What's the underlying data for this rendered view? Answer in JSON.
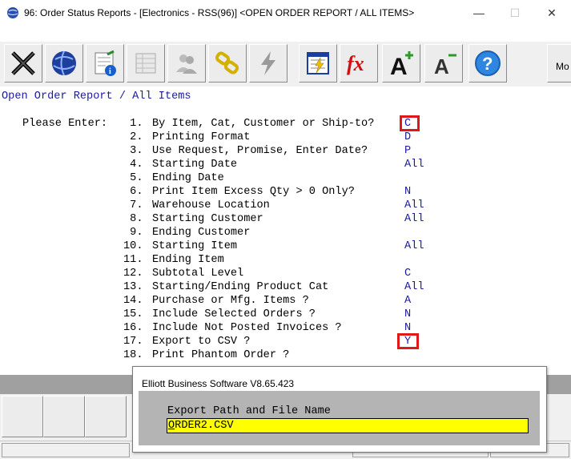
{
  "window": {
    "title": "96: Order Status Reports - [Electronics - RSS(96)] <OPEN ORDER REPORT / ALL ITEMS>",
    "minimize": "—",
    "maximize": "☐",
    "close": "✕"
  },
  "toolbar": {
    "buttons": [
      "exit-icon",
      "globe-icon",
      "notepad-info-icon",
      "grid-icon",
      "users-icon",
      "chain-link-icon",
      "lightning-icon",
      "report-lightning-icon",
      "fx-icon",
      "font-increase-icon",
      "font-decrease-icon",
      "help-icon"
    ],
    "more_label": "Mo"
  },
  "screen": {
    "report_title": "Open Order Report / All Items",
    "prompt_label": "Please Enter:",
    "options": [
      {
        "num": " 1.",
        "label": "By Item, Cat, Customer or Ship-to?",
        "value": "C"
      },
      {
        "num": " 2.",
        "label": "Printing Format",
        "value": "D"
      },
      {
        "num": " 3.",
        "label": "Use Request, Promise, Enter Date?",
        "value": "P"
      },
      {
        "num": " 4.",
        "label": "Starting Date",
        "value": "All"
      },
      {
        "num": " 5.",
        "label": "Ending Date",
        "value": ""
      },
      {
        "num": " 6.",
        "label": "Print Item Excess Qty > 0 Only?",
        "value": "N"
      },
      {
        "num": " 7.",
        "label": "Warehouse Location",
        "value": "All"
      },
      {
        "num": " 8.",
        "label": "Starting Customer",
        "value": "All"
      },
      {
        "num": " 9.",
        "label": "Ending Customer",
        "value": ""
      },
      {
        "num": "10.",
        "label": "Starting Item",
        "value": "All"
      },
      {
        "num": "11.",
        "label": "Ending Item",
        "value": ""
      },
      {
        "num": "12.",
        "label": "Subtotal Level",
        "value": "C"
      },
      {
        "num": "13.",
        "label": "Starting/Ending Product Cat",
        "value": "All"
      },
      {
        "num": "14.",
        "label": "Purchase or Mfg. Items ?",
        "value": "A"
      },
      {
        "num": "15.",
        "label": "Include Selected Orders ?",
        "value": "N"
      },
      {
        "num": "16.",
        "label": "Include Not Posted Invoices ?",
        "value": "N"
      },
      {
        "num": "17.",
        "label": "Export to CSV ?",
        "value": "Y"
      },
      {
        "num": "18.",
        "label": "Print Phantom Order ?",
        "value": ""
      }
    ]
  },
  "dialog": {
    "title": "Elliott Business Software V8.65.423",
    "label": "Export Path and File Name",
    "input_first_char": "O",
    "input_rest": "RDER2.CSV"
  },
  "colors": {
    "value_text": "#1a1aa0",
    "highlight_box": "#e01818",
    "input_bg": "#ffff00"
  }
}
